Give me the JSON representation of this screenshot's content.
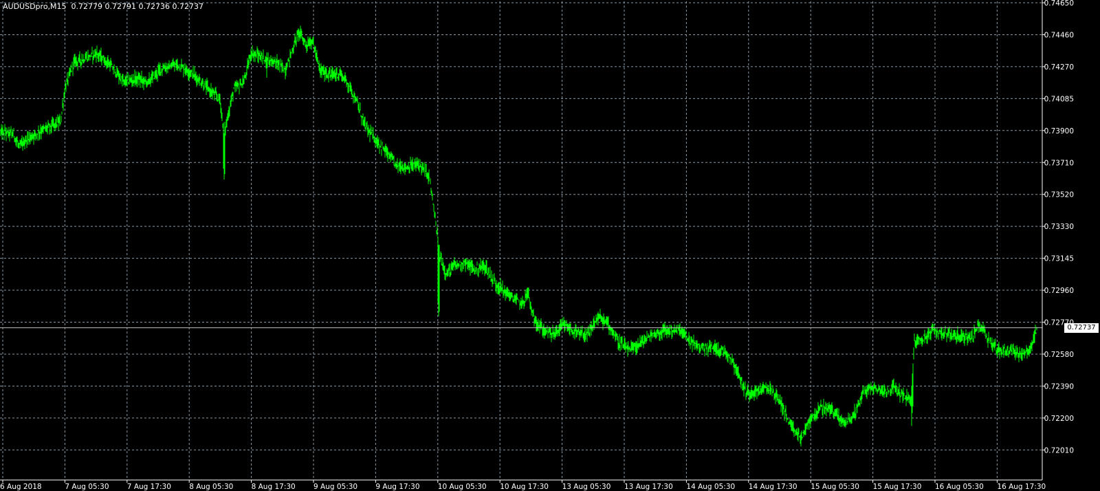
{
  "chart_window": {
    "symbol": "AUDUSDpro,M15",
    "ohlc_text": "0.72779 0.72791 0.72736 0.72737",
    "current_price_label": "0.72737"
  },
  "colors": {
    "background": "#000000",
    "grid": "#8a9aa8",
    "candles": "#00ff00",
    "axis_text": "#ffffff",
    "current_price_line": "#c0c0c0"
  },
  "chart_data": {
    "type": "line",
    "title": "",
    "y_ticks": [
      "0.74650",
      "0.74460",
      "0.74270",
      "0.74085",
      "0.73900",
      "0.73710",
      "0.73520",
      "0.73330",
      "0.73145",
      "0.72960",
      "0.72770",
      "0.72580",
      "0.72390",
      "0.72200",
      "0.72010"
    ],
    "x_ticks": [
      "6 Aug 2018",
      "7 Aug 05:30",
      "7 Aug 17:30",
      "8 Aug 05:30",
      "8 Aug 17:30",
      "9 Aug 05:30",
      "9 Aug 17:30",
      "10 Aug 05:30",
      "10 Aug 17:30",
      "13 Aug 05:30",
      "13 Aug 17:30",
      "14 Aug 05:30",
      "14 Aug 17:30",
      "15 Aug 05:30",
      "15 Aug 17:30",
      "16 Aug 05:30",
      "16 Aug 17:30"
    ],
    "ylim": [
      0.7195,
      0.7466
    ],
    "grid": true,
    "current_price": 0.72737,
    "series": [
      {
        "x": [
          "6 Aug 2018",
          "7 Aug 05:30",
          "7 Aug 17:30",
          "8 Aug 05:30",
          "8 Aug 17:30",
          "9 Aug 05:30",
          "9 Aug 17:30",
          "10 Aug 05:30",
          "10 Aug 17:30",
          "13 Aug 05:30",
          "13 Aug 17:30",
          "14 Aug 05:30",
          "14 Aug 17:30",
          "15 Aug 05:30",
          "15 Aug 17:30",
          "16 Aug 05:30",
          "16 Aug 17:30"
        ],
        "values": [
          0.7388,
          0.7432,
          0.7425,
          0.7412,
          0.7435,
          0.7425,
          0.737,
          0.73,
          0.728,
          0.7275,
          0.7265,
          0.727,
          0.7238,
          0.723,
          0.724,
          0.727,
          0.726
        ]
      }
    ]
  }
}
